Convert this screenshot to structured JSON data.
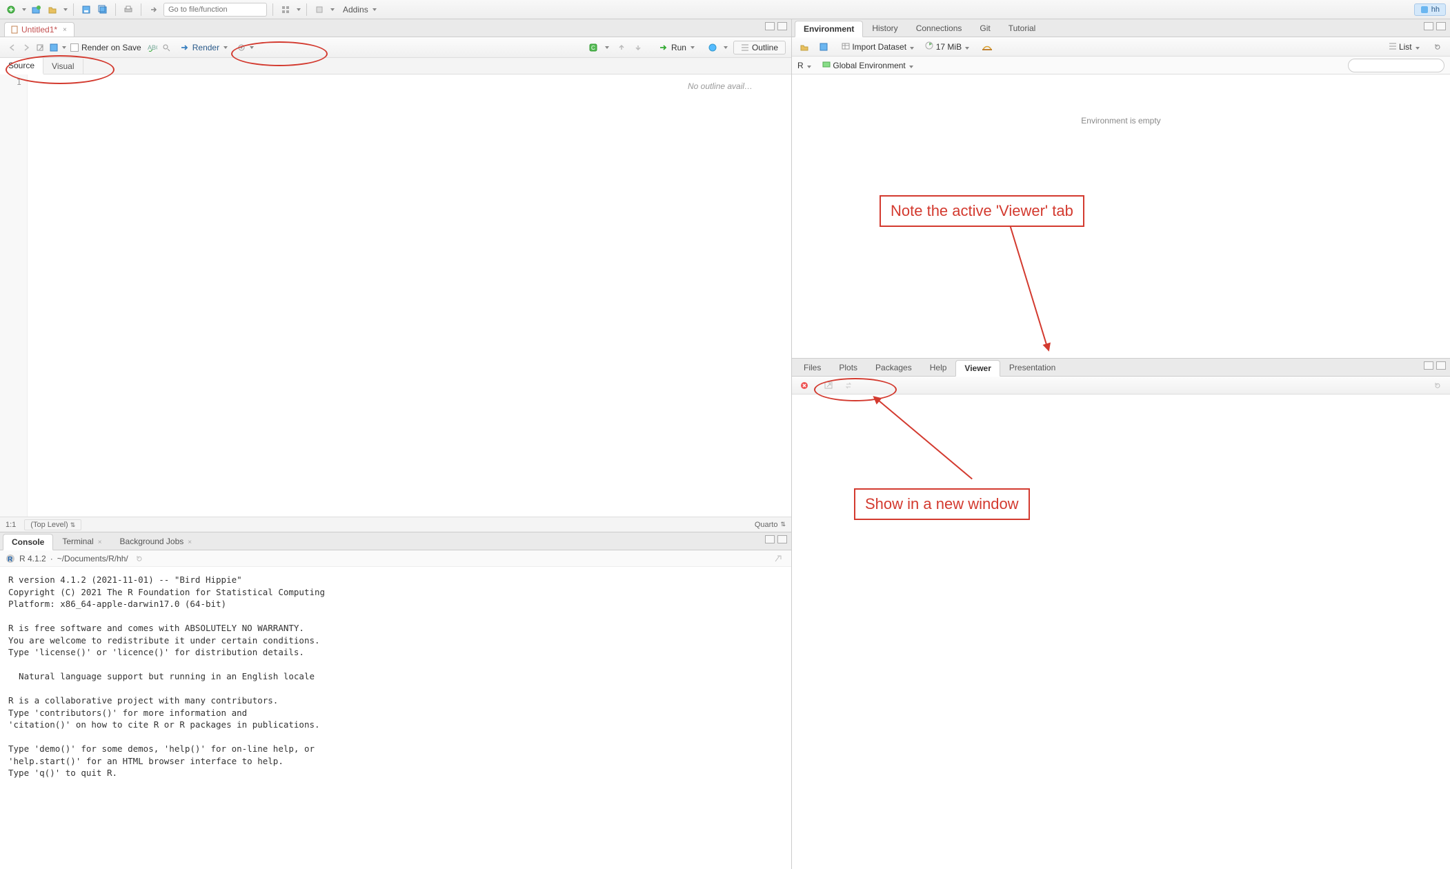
{
  "top": {
    "goto_placeholder": "Go to file/function",
    "addins_label": "Addins",
    "project_badge": "hh"
  },
  "source": {
    "tab_title": "Untitled1*",
    "render_on_save": "Render on Save",
    "render": "Render",
    "run": "Run",
    "outline_btn": "Outline",
    "mode_source": "Source",
    "mode_visual": "Visual",
    "gutter_line": "1",
    "outline_text": "No outline avail…",
    "status_pos": "1:1",
    "status_scope": "(Top Level)",
    "status_type": "Quarto"
  },
  "console": {
    "tabs": {
      "console": "Console",
      "terminal": "Terminal",
      "bgjobs": "Background Jobs"
    },
    "version": "R 4.1.2",
    "path": "~/Documents/R/hh/",
    "body": "R version 4.1.2 (2021-11-01) -- \"Bird Hippie\"\nCopyright (C) 2021 The R Foundation for Statistical Computing\nPlatform: x86_64-apple-darwin17.0 (64-bit)\n\nR is free software and comes with ABSOLUTELY NO WARRANTY.\nYou are welcome to redistribute it under certain conditions.\nType 'license()' or 'licence()' for distribution details.\n\n  Natural language support but running in an English locale\n\nR is a collaborative project with many contributors.\nType 'contributors()' for more information and\n'citation()' on how to cite R or R packages in publications.\n\nType 'demo()' for some demos, 'help()' for on-line help, or\n'help.start()' for an HTML browser interface to help.\nType 'q()' to quit R.\n"
  },
  "env": {
    "tabs": {
      "environment": "Environment",
      "history": "History",
      "connections": "Connections",
      "git": "Git",
      "tutorial": "Tutorial"
    },
    "import": "Import Dataset",
    "mem": "17 MiB",
    "list_label": "List",
    "r_label": "R",
    "global_env": "Global Environment",
    "empty": "Environment is empty"
  },
  "viewer": {
    "tabs": {
      "files": "Files",
      "plots": "Plots",
      "packages": "Packages",
      "help": "Help",
      "viewer": "Viewer",
      "presentation": "Presentation"
    }
  },
  "annotations": {
    "note1": "Note the active 'Viewer' tab",
    "note2": "Show in a new window"
  }
}
